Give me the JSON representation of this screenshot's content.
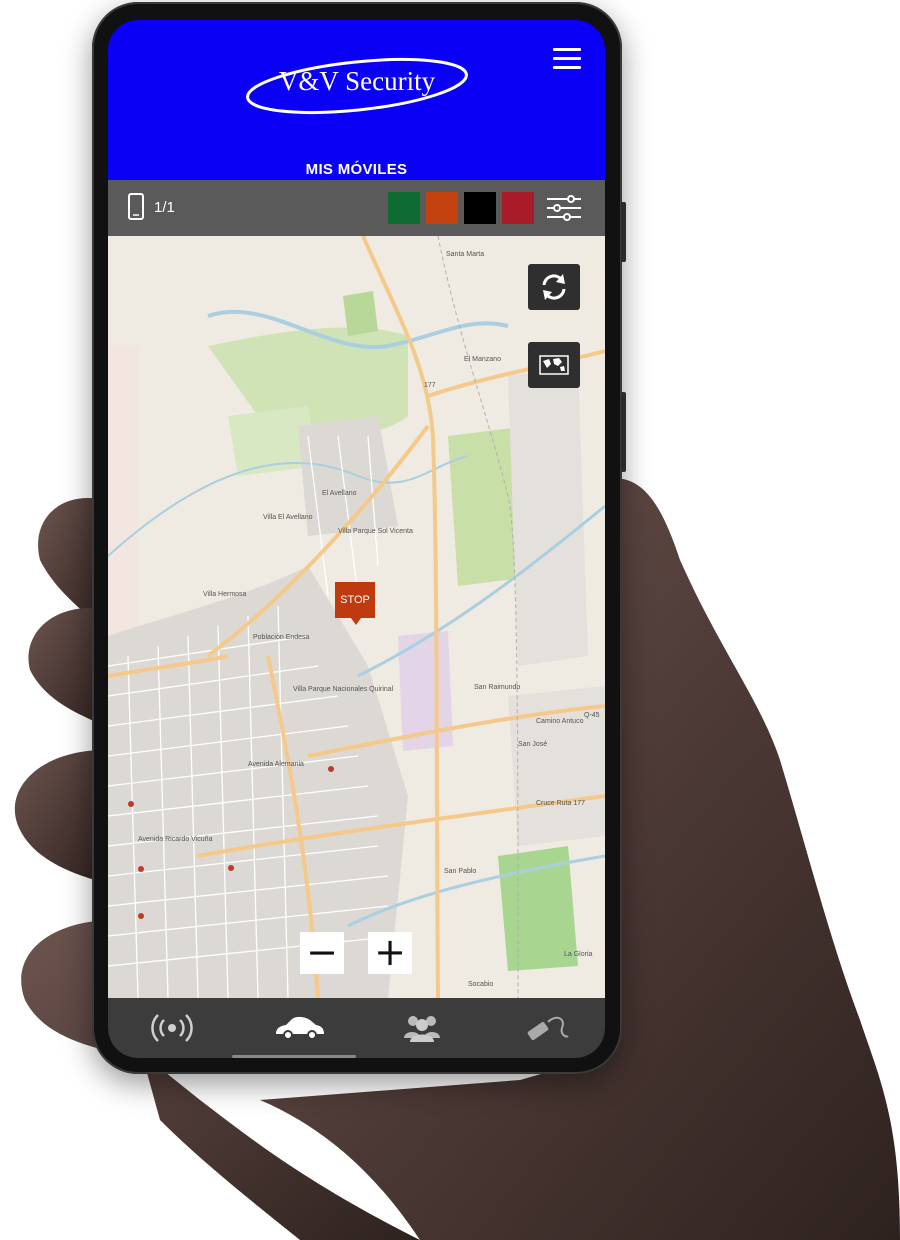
{
  "app": {
    "logo_text": "V&V Security",
    "section_title": "MIS MÓVILES"
  },
  "toolbar": {
    "counter": "1/1",
    "color_filters": [
      "#0e6b32",
      "#c3420f",
      "#000000",
      "#a91a27"
    ]
  },
  "map": {
    "marker_label": "STOP",
    "zoom_out_label": "−",
    "zoom_in_label": "+",
    "labels": [
      "El Avellano",
      "Villa El Avellano",
      "Villa Parque Sol Vicenta",
      "Villa Hermosa",
      "Población Endesa",
      "Villa Parque Nacionales Quirinal",
      "Avenida Alemania",
      "Avenida Ricardo Vicuña",
      "San Raimundo",
      "San José",
      "San Pablo",
      "El Manzano",
      "Santa Marta",
      "La Gloria",
      "Socabio",
      "Camino Antuco",
      "Cruce Ruta 177",
      "177",
      "Q-45"
    ]
  },
  "icons": {
    "refresh": "refresh-icon",
    "layers": "world-map-icon",
    "menu": "hamburger-menu-icon",
    "device": "smartphone-icon",
    "filter": "sliders-icon"
  },
  "nav": {
    "items": [
      "broadcast-icon",
      "car-icon",
      "group-icon",
      "key-icon"
    ],
    "active_index": 1
  }
}
